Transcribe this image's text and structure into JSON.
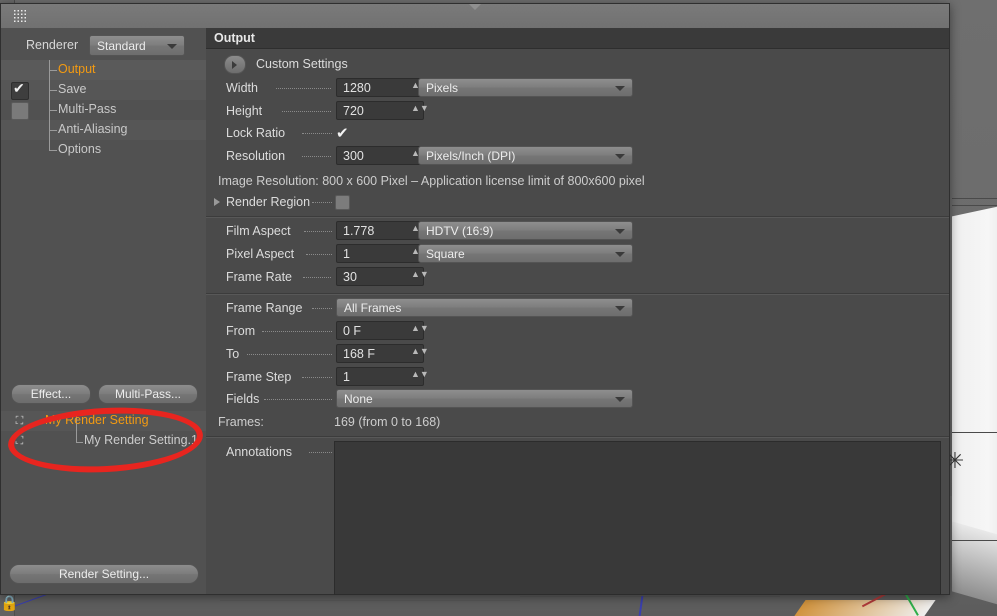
{
  "window": {
    "title_grip": "window-grip"
  },
  "left_panel": {
    "renderer_label": "Renderer",
    "renderer_value": "Standard",
    "tree_items": [
      {
        "label": "Output",
        "checkbox": "none",
        "active": true
      },
      {
        "label": "Save",
        "checkbox": "checked",
        "active": false
      },
      {
        "label": "Multi-Pass",
        "checkbox": "empty",
        "active": false
      },
      {
        "label": "Anti-Aliasing",
        "checkbox": "none",
        "active": false
      },
      {
        "label": "Options",
        "checkbox": "none",
        "active": false
      }
    ],
    "effect_button": "Effect...",
    "multipass_button": "Multi-Pass...",
    "render_settings": [
      {
        "label": "My Render Setting",
        "active": true,
        "child": false
      },
      {
        "label": "My Render Setting.1",
        "active": false,
        "child": true
      }
    ],
    "render_setting_button": "Render Setting..."
  },
  "output": {
    "section_title": "Output",
    "custom_settings_label": "Custom Settings",
    "width_label": "Width",
    "width_value": "1280",
    "width_unit": "Pixels",
    "height_label": "Height",
    "height_value": "720",
    "lock_ratio_label": "Lock Ratio",
    "lock_ratio_checked": "✔",
    "resolution_label": "Resolution",
    "resolution_value": "300",
    "resolution_unit": "Pixels/Inch (DPI)",
    "image_resolution_info": "Image Resolution:  800 x 600 Pixel – Application license limit of 800x600 pixel",
    "render_region_label": "Render Region",
    "film_aspect_label": "Film Aspect",
    "film_aspect_value": "1.778",
    "film_aspect_preset": "HDTV (16:9)",
    "pixel_aspect_label": "Pixel Aspect",
    "pixel_aspect_value": "1",
    "pixel_aspect_preset": "Square",
    "frame_rate_label": "Frame Rate",
    "frame_rate_value": "30",
    "frame_range_label": "Frame Range",
    "frame_range_value": "All Frames",
    "from_label": "From",
    "from_value": "0 F",
    "to_label": "To",
    "to_value": "168 F",
    "frame_step_label": "Frame Step",
    "frame_step_value": "1",
    "fields_label": "Fields",
    "fields_value": "None",
    "frames_label": "Frames:",
    "frames_value": "169 (from 0 to 168)",
    "annotations_label": "Annotations"
  },
  "annotation": {
    "highlight_color": "#e8251f",
    "highlight_target": "My Render Setting.1"
  },
  "icons": {
    "spin_up": "▲",
    "spin_down": "▼",
    "axis_star": "✳",
    "lock": "🔒",
    "render_setting_icon": "⛶"
  }
}
